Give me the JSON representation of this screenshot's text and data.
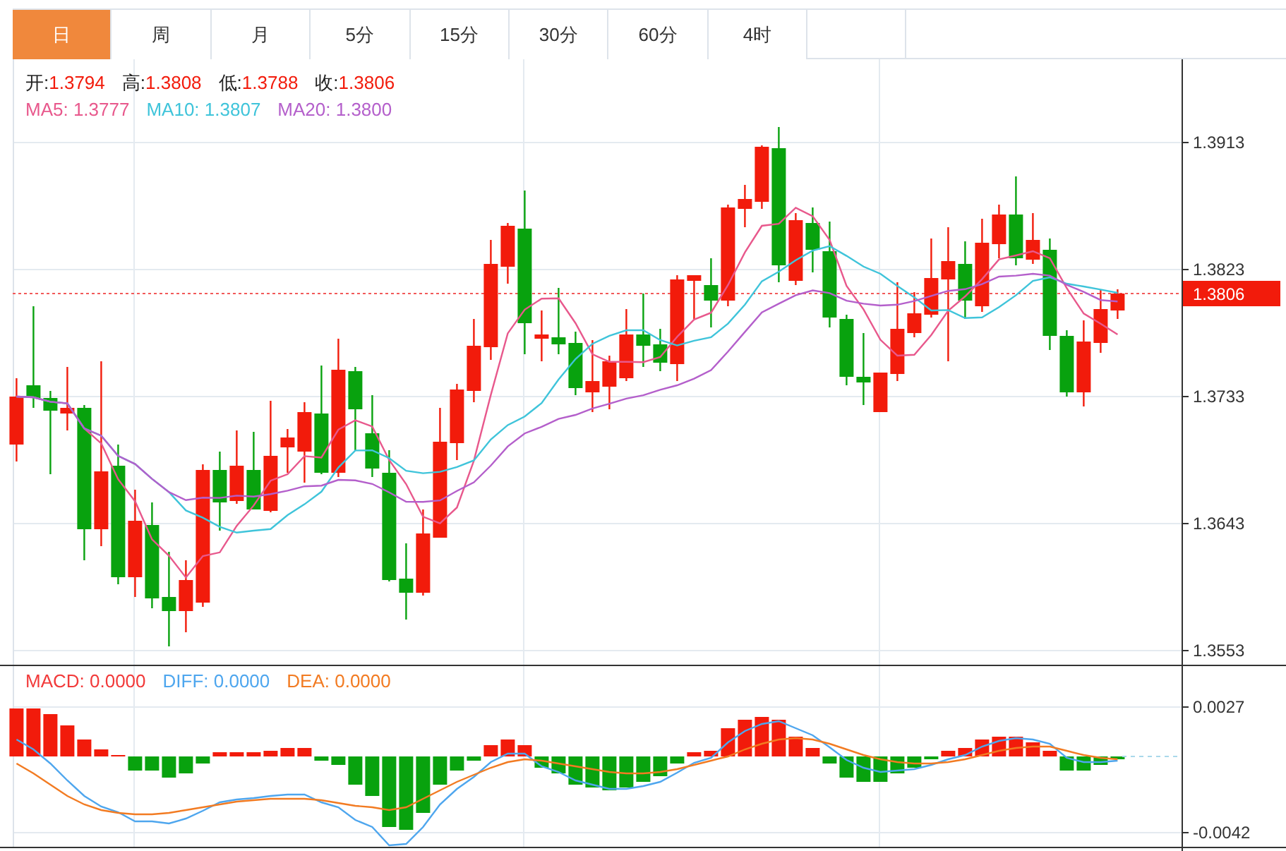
{
  "tabs": [
    {
      "label": "日",
      "selected": true
    },
    {
      "label": "周",
      "selected": false
    },
    {
      "label": "月",
      "selected": false
    },
    {
      "label": "5分",
      "selected": false
    },
    {
      "label": "15分",
      "selected": false
    },
    {
      "label": "30分",
      "selected": false
    },
    {
      "label": "60分",
      "selected": false
    },
    {
      "label": "4时",
      "selected": false
    }
  ],
  "ohlc": [
    {
      "label": "开:",
      "value": "1.3794"
    },
    {
      "label": "高:",
      "value": "1.3808"
    },
    {
      "label": "低:",
      "value": "1.3788"
    },
    {
      "label": "收:",
      "value": "1.3806"
    }
  ],
  "moving_averages": [
    {
      "label": "MA5:",
      "value": "1.3777",
      "color": "#e8588c"
    },
    {
      "label": "MA10:",
      "value": "1.3807",
      "color": "#3fc4da"
    },
    {
      "label": "MA20:",
      "value": "1.3800",
      "color": "#b45fcb"
    }
  ],
  "price_axis": [
    "1.3913",
    "1.3823",
    "1.3733",
    "1.3643",
    "1.3553"
  ],
  "current_price": "1.3806",
  "macd_legend": [
    {
      "label": "MACD:",
      "value": "0.0000",
      "color": "#f23a3a"
    },
    {
      "label": "DIFF:",
      "value": "0.0000",
      "color": "#4ea6ee"
    },
    {
      "label": "DEA:",
      "value": "0.0000",
      "color": "#f27b22"
    }
  ],
  "macd_axis": [
    "0.0027",
    "-0.0042"
  ]
}
